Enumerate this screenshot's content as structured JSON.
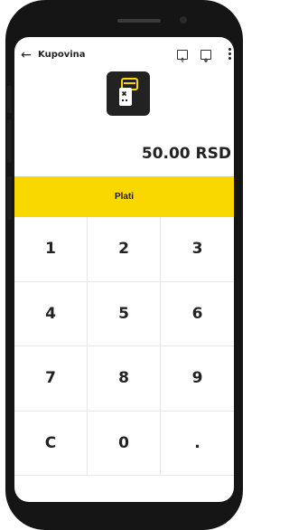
{
  "header": {
    "back_icon": "arrow-left-icon",
    "title": "Kupovina",
    "icons": [
      "upload-folder-icon",
      "save-box-icon",
      "more-vert-icon"
    ]
  },
  "logo": {
    "icon": "pos-terminal-icon"
  },
  "amount": "50.00 RSD",
  "pay_label": "Plati",
  "keypad": {
    "keys": [
      "1",
      "2",
      "3",
      "4",
      "5",
      "6",
      "7",
      "8",
      "9",
      "C",
      "0",
      "."
    ]
  },
  "colors": {
    "accent": "#F9D800",
    "text": "#222222",
    "logo_bg": "#222222"
  }
}
